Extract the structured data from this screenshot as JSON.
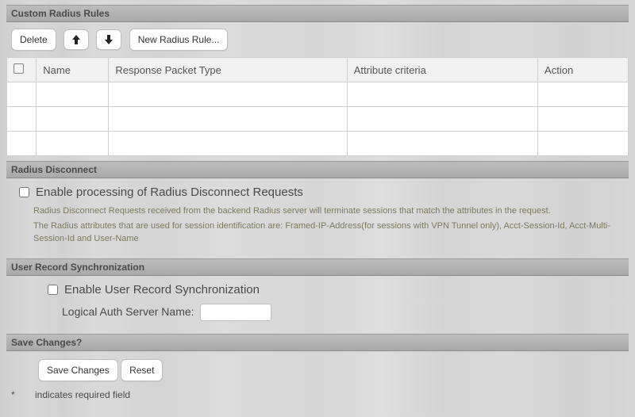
{
  "sections": {
    "rules_title": "Custom Radius Rules",
    "disconnect_title": "Radius Disconnect",
    "sync_title": "User Record Synchronization",
    "save_title": "Save Changes?"
  },
  "toolbar": {
    "delete": "Delete",
    "new_rule": "New Radius Rule..."
  },
  "table": {
    "headers": {
      "name": "Name",
      "response": "Response Packet Type",
      "attribute": "Attribute criteria",
      "action": "Action"
    },
    "rows": [
      {
        "name": "",
        "response": "",
        "attribute": "",
        "action": ""
      },
      {
        "name": "",
        "response": "",
        "attribute": "",
        "action": ""
      },
      {
        "name": "",
        "response": "",
        "attribute": "",
        "action": ""
      }
    ]
  },
  "disconnect": {
    "enable_label": "Enable processing of Radius Disconnect Requests",
    "enable_checked": false,
    "desc1": "Radius Disconnect Requests received from the backend Radius server will terminate sessions that match the attributes in the request.",
    "desc2": "The Radius attributes that are used for session identification are: Framed-IP-Address(for sessions with VPN Tunnel only), Acct-Session-Id, Acct-Multi-Session-Id and User-Name"
  },
  "sync": {
    "enable_label": "Enable User Record Synchronization",
    "enable_checked": false,
    "logical_label": "Logical Auth Server Name:",
    "logical_value": ""
  },
  "save": {
    "save_btn": "Save Changes",
    "reset_btn": "Reset"
  },
  "footnote": "indicates required field"
}
